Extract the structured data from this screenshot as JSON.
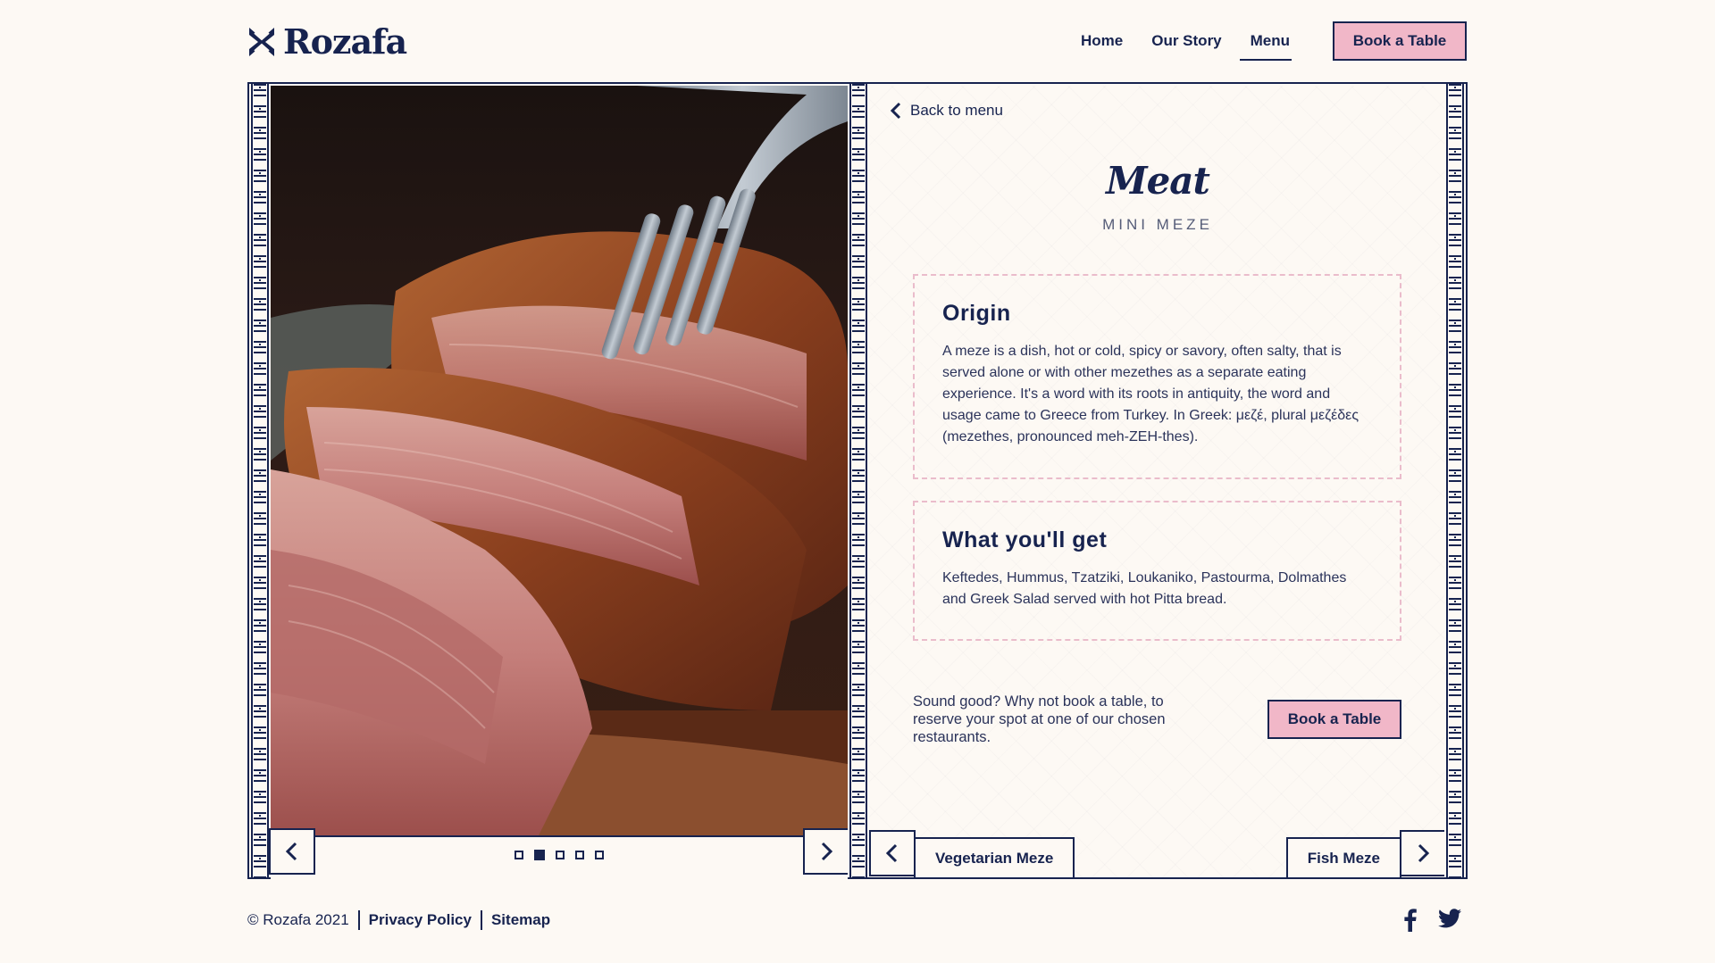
{
  "brand": {
    "name": "Rozafa"
  },
  "nav": {
    "items": [
      "Home",
      "Our Story",
      "Menu"
    ],
    "active": "Menu",
    "book_label": "Book a Table"
  },
  "gallery": {
    "slide_count": 5,
    "active_slide": 2
  },
  "detail": {
    "back_label": "Back to menu",
    "title": "Meat",
    "subtitle": "MINI MEZE",
    "origin_heading": "Origin",
    "origin_text": "A meze is a dish, hot or cold, spicy or savory, often salty, that is served alone or with other mezethes as a separate eating experience. It's a word with its roots in antiquity, the word and usage came to Greece from Turkey. In Greek: μεζέ, plural μεζέδες (mezethes, pronounced meh-ZEH-thes).",
    "get_heading": "What you'll get",
    "get_text": "Keftedes, Hummus, Tzatziki, Loukaniko, Pastourma, Dolmathes and Greek Salad served with hot Pitta bread.",
    "cta_text": "Sound good? Why not book a table, to reserve your spot at one of our chosen restaurants.",
    "cta_book_label": "Book a Table",
    "prev_label": "Vegetarian Meze",
    "next_label": "Fish Meze"
  },
  "footer": {
    "copyright": "© Rozafa 2021",
    "privacy_label": "Privacy Policy",
    "sitemap_label": "Sitemap",
    "social": [
      "facebook-icon",
      "twitter-icon"
    ]
  },
  "colors": {
    "navy": "#17234f",
    "pink": "#f1b7c8",
    "cream": "#fdf9f4"
  }
}
